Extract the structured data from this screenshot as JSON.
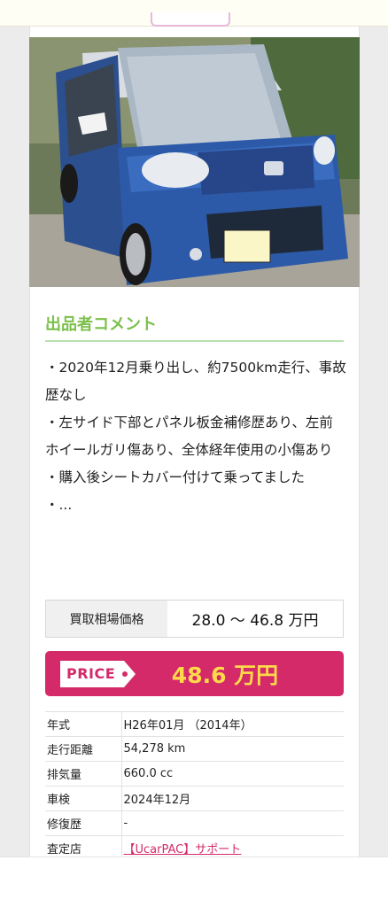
{
  "comment_section": {
    "title": "出品者コメント",
    "lines": [
      "・2020年12月乗り出し、約7500km走行、事故歴なし",
      "・左サイド下部とパネル板金補修歴あり、左前ホイールガリ傷あり、全体経年使用の小傷あり",
      "・購入後シートカバー付けて乗ってました",
      "・..."
    ]
  },
  "market_price": {
    "label": "買取相場価格",
    "value": "28.0 〜 46.8 万円"
  },
  "price": {
    "badge": "PRICE",
    "value": "48.6 万円"
  },
  "specs": [
    {
      "key": "年式",
      "value": "H26年01月 （2014年）"
    },
    {
      "key": "走行距離",
      "value": "54,278 km"
    },
    {
      "key": "排気量",
      "value": "660.0 cc"
    },
    {
      "key": "車検",
      "value": "2024年12月"
    },
    {
      "key": "修復歴",
      "value": "-"
    },
    {
      "key": "査定店",
      "value": "【UcarPAC】サポート"
    }
  ],
  "colors": {
    "accent": "#d42a6a",
    "price_text": "#ffd94a",
    "section_title": "#7cc04b"
  }
}
